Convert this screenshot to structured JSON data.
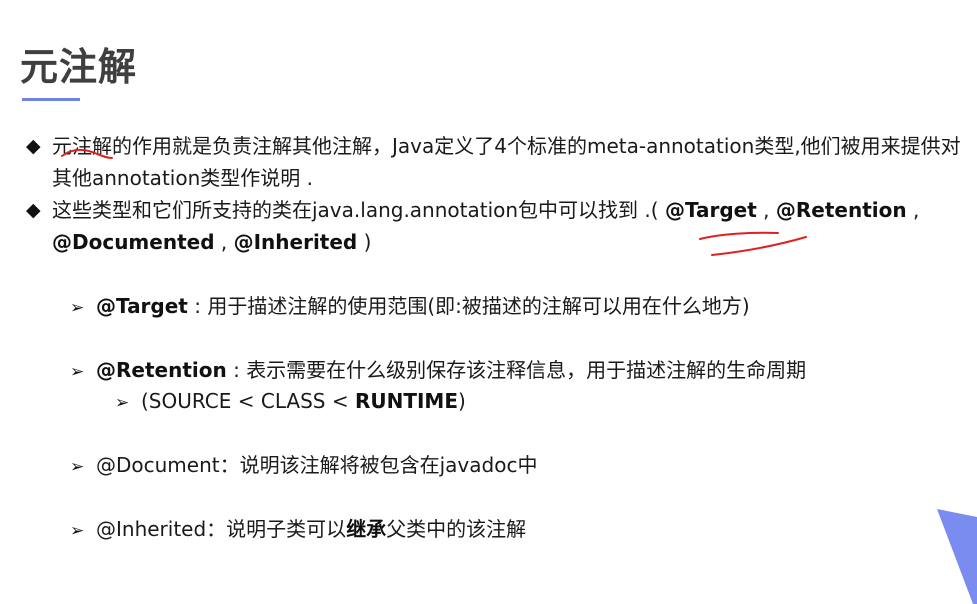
{
  "title": "元注解",
  "bullets": {
    "b1_prefix": "元注解",
    "b1_rest": "的作用就是负责注解其他注解，Java定义了4个标准的meta-annotation类型,他们被用来提供对其他annotation类型作说明 .",
    "b2_prefix": "这些类型和它们所支持的类在java.lang.annotation包中可以找到 .( ",
    "b2_target": "@Target",
    "b2_sep1": " , ",
    "b2_retention": "@Retention",
    "b2_sep2": " ,",
    "b2_documented": "@Documented",
    "b2_sep3": " , ",
    "b2_inherited": "@Inherited",
    "b2_close": " )"
  },
  "subitems": {
    "target_name": "@Target",
    "target_desc": " : 用于描述注解的使用范围(即:被描述的注解可以用在什么地方)",
    "retention_name": "@Retention",
    "retention_desc": " : 表示需要在什么级别保存该注释信息，用于描述注解的生命周期",
    "retention_levels_prefix": "(SOURCE < CLASS  <  ",
    "retention_levels_runtime": "RUNTIME",
    "retention_levels_suffix": ")",
    "document_text": "@Document：说明该注解将被包含在javadoc中",
    "inherited_prefix": "@Inherited：说明子类可以",
    "inherited_bold": "继承",
    "inherited_suffix": "父类中的该注解"
  },
  "icons": {
    "bullet": "diamond-icon",
    "sub_bullet": "arrowhead-icon"
  },
  "colors": {
    "title": "#3f3f3f",
    "title_underline": "#6f83e0",
    "annotation_ink": "#e02020",
    "corner_accent": "#7a8cf0"
  }
}
